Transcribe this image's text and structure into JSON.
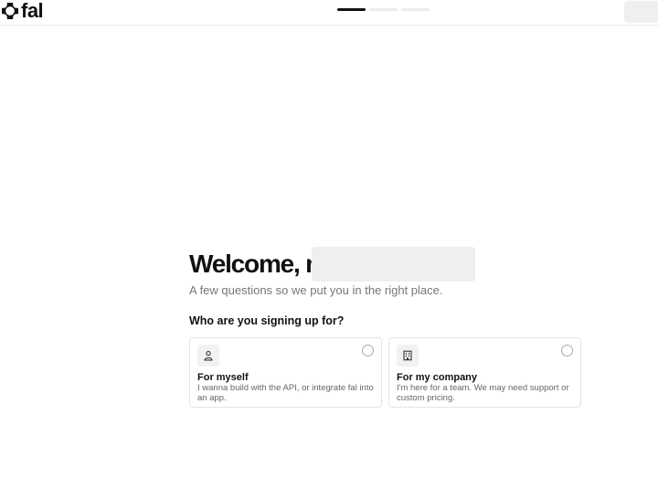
{
  "header": {
    "logo_text": "fal",
    "progress": {
      "total_steps": 3,
      "current_step": 1
    }
  },
  "main": {
    "welcome_text": "Welcome, m",
    "subtitle": "A few questions so we put you in the right place.",
    "question": "Who are you signing up for?",
    "options": [
      {
        "title": "For myself",
        "description": "I wanna build with the API, or integrate fal into an app.",
        "icon": "person-icon",
        "selected": false
      },
      {
        "title": "For my company",
        "description": "I'm here for a team. We may need support or custom pricing.",
        "icon": "building-icon",
        "selected": false
      }
    ]
  },
  "colors": {
    "text_primary": "#111111",
    "text_secondary": "#777777",
    "progress_active": "#111111",
    "progress_inactive": "#ececec",
    "card_border": "#e4e4e4"
  }
}
